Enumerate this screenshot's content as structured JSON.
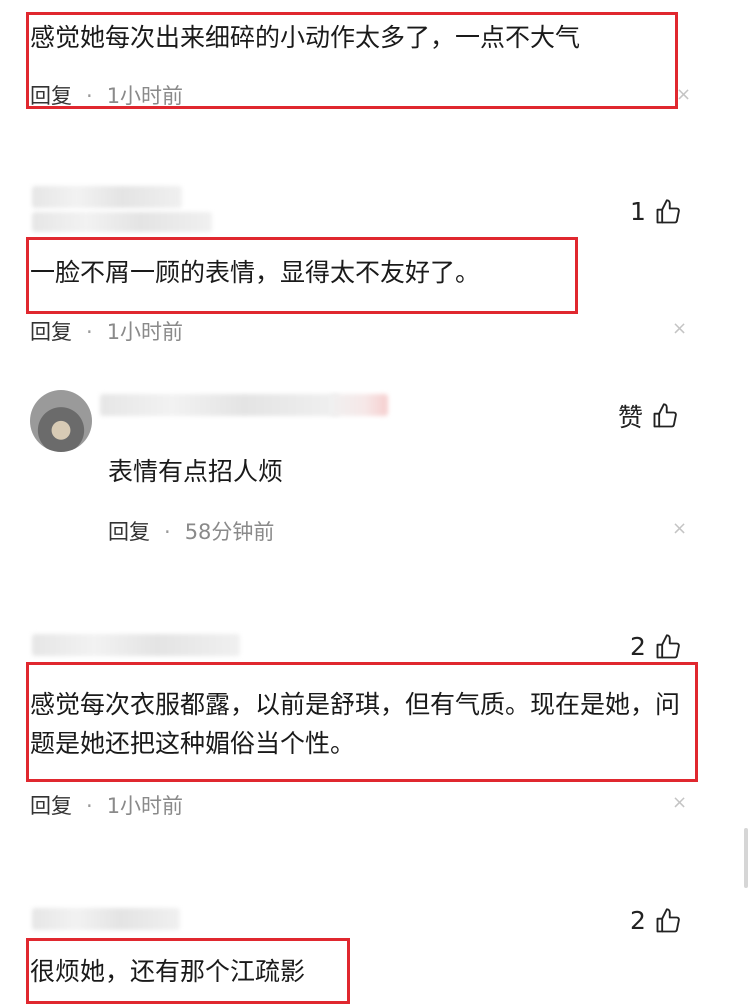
{
  "comments": [
    {
      "text": "感觉她每次出来细碎的小动作太多了，一点不大气",
      "reply_label": "回复",
      "time": "1小时前",
      "close": "×"
    },
    {
      "likes": "1",
      "text": "一脸不屑一顾的表情，显得太不友好了。",
      "reply_label": "回复",
      "time": "1小时前",
      "close": "×"
    },
    {
      "likes": "赞",
      "text": "表情有点招人烦",
      "reply_label": "回复",
      "time": "58分钟前",
      "close": "×"
    },
    {
      "likes": "2",
      "text": "感觉每次衣服都露，以前是舒琪，但有气质。现在是她，问题是她还把这种媚俗当个性。",
      "reply_label": "回复",
      "time": "1小时前",
      "close": "×"
    },
    {
      "likes": "2",
      "text": "很烦她，还有那个江疏影"
    }
  ],
  "colors": {
    "highlight_box": "#e0282f",
    "meta_text": "#8a8a8a"
  }
}
